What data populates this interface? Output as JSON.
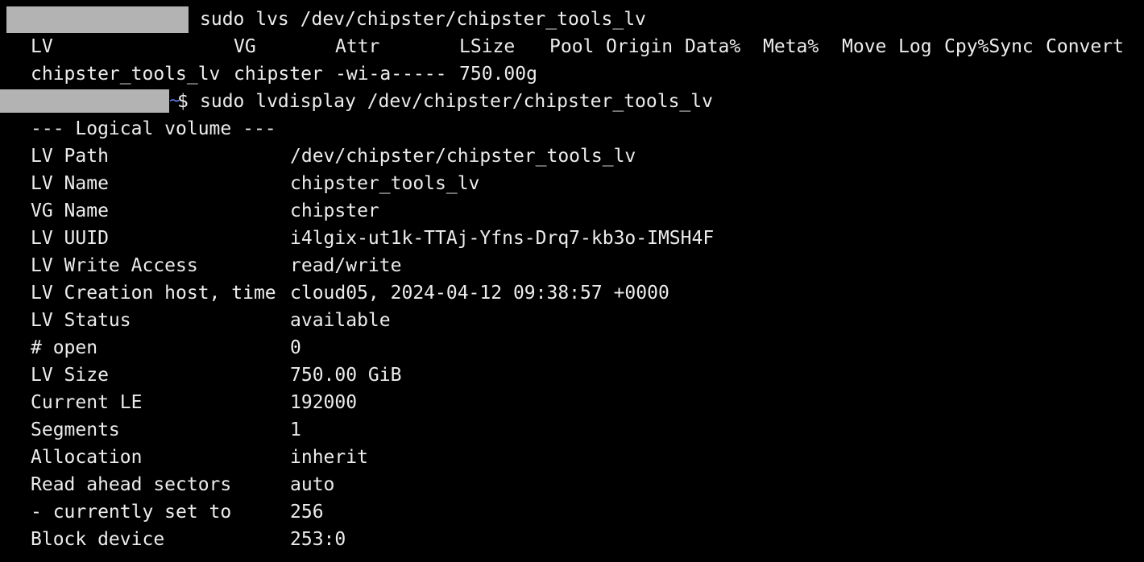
{
  "theme": {
    "background": "#000000",
    "foreground": "#ececec",
    "redaction": "#b3b3b3",
    "prompt_tilde": "#5b6fd6"
  },
  "prompt1": {
    "command": "sudo lvs /dev/chipster/chipster_tools_lv"
  },
  "lvs": {
    "headers": [
      "LV",
      "VG",
      "Attr",
      "LSize",
      "Pool",
      "Origin",
      "Data%",
      "Meta%",
      "Move",
      "Log",
      "Cpy%Sync",
      "Convert"
    ],
    "row": [
      "chipster_tools_lv",
      "chipster",
      "-wi-a-----",
      "750.00g"
    ]
  },
  "prompt2": {
    "tilde": "~",
    "symbol": "$",
    "command": "sudo lvdisplay /dev/chipster/chipster_tools_lv"
  },
  "lvdisplay": {
    "heading": "--- Logical volume ---",
    "rows": [
      {
        "key": "LV Path",
        "value": "/dev/chipster/chipster_tools_lv"
      },
      {
        "key": "LV Name",
        "value": "chipster_tools_lv"
      },
      {
        "key": "VG Name",
        "value": "chipster"
      },
      {
        "key": "LV UUID",
        "value": "i4lgix-ut1k-TTAj-Yfns-Drq7-kb3o-IMSH4F"
      },
      {
        "key": "LV Write Access",
        "value": "read/write"
      },
      {
        "key": "LV Creation host, time",
        "value": "cloud05, 2024-04-12 09:38:57 +0000"
      },
      {
        "key": "LV Status",
        "value": "available"
      },
      {
        "key": "# open",
        "value": "0"
      },
      {
        "key": "LV Size",
        "value": "750.00 GiB"
      },
      {
        "key": "Current LE",
        "value": "192000"
      },
      {
        "key": "Segments",
        "value": "1"
      },
      {
        "key": "Allocation",
        "value": "inherit"
      },
      {
        "key": "Read ahead sectors",
        "value": "auto"
      },
      {
        "key": "- currently set to",
        "value": "256"
      },
      {
        "key": "Block device",
        "value": "253:0"
      }
    ]
  }
}
